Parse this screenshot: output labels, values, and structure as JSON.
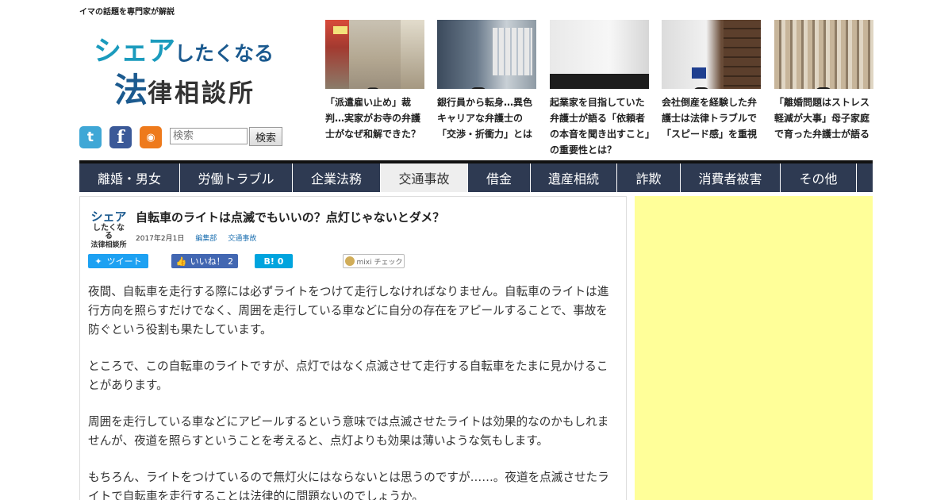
{
  "header": {
    "tagline": "イマの話題を専門家が解説",
    "logo": {
      "line1_big": "シェア",
      "line1_small": "したくなる",
      "line2_big": "法",
      "line2_rest": "律相談所"
    },
    "social": {
      "twitter": "t",
      "facebook": "f",
      "rss": "◉"
    },
    "search": {
      "placeholder": "検索",
      "button": "検索"
    }
  },
  "features": [
    {
      "caption": "「派遣雇い止め」裁判…実家がお寺の弁護士がなぜ和解できた？"
    },
    {
      "caption": "銀行員から転身…異色キャリアな弁護士の「交渉・折衝力」とは"
    },
    {
      "caption": "起業家を目指していた弁護士が語る「依頼者の本音を聞き出すこと」の重要性とは？"
    },
    {
      "caption": "会社倒産を経験した弁護士は法律トラブルで「スピード感」を重視"
    },
    {
      "caption": "「離婚問題はストレス軽減が大事」母子家庭で育った弁護士が語る"
    }
  ],
  "nav": [
    {
      "label": "離婚・男女"
    },
    {
      "label": "労働トラブル"
    },
    {
      "label": "企業法務"
    },
    {
      "label": "交通事故"
    },
    {
      "label": "借金"
    },
    {
      "label": "遺産相続"
    },
    {
      "label": "詐欺"
    },
    {
      "label": "消費者被害"
    },
    {
      "label": "その他"
    }
  ],
  "article": {
    "logo": {
      "a1": "シェア",
      "a2": "したくなる",
      "a3": "法律相談所"
    },
    "title": "自転車のライトは点滅でもいいの？点灯じゃないとダメ？",
    "date": "2017年2月1日",
    "author": "編集部",
    "category": "交通事故",
    "share": {
      "tweet": "ツイート",
      "like": "いいね！ 2",
      "hatena": "B! 0",
      "mixi": "mixi チェック"
    },
    "paragraphs": [
      "夜間、自転車を走行する際には必ずライトをつけて走行しなければなりません。自転車のライトは進行方向を照らすだけでなく、周囲を走行している車などに自分の存在をアピールすることで、事故を防ぐという役割も果たしています。",
      "ところで、この自転車のライトですが、点灯ではなく点滅させて走行する自転車をたまに見かけることがあります。",
      "周囲を走行している車などにアピールするという意味では点滅させたライトは効果的なのかもしれませんが、夜道を照らすということを考えると、点灯よりも効果は薄いような気もします。",
      "もちろん、ライトをつけているので無灯火にはならないとは思うのですが……。夜道を点滅させたライトで自転車を走行することは法律的に問題ないのでしょうか。"
    ]
  },
  "colors": {
    "nav_bg": "#2e3a52",
    "accent": "#1b9bbd",
    "brand_dark": "#1b5a8f",
    "ad_bg": "#ffff99"
  }
}
